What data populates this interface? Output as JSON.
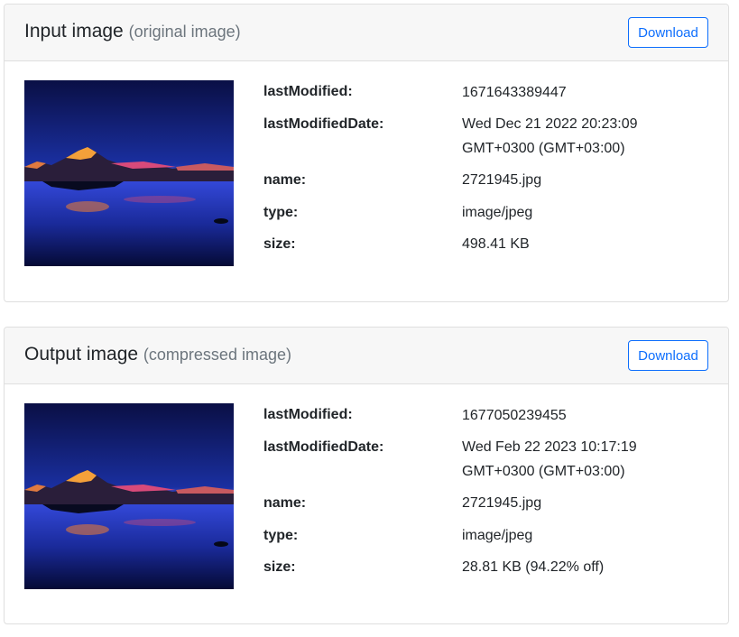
{
  "cards": {
    "input": {
      "title": "Input image",
      "subtitle": "(original image)",
      "download_label": "Download",
      "thumbnail": "night-mountain-lake-photo",
      "meta": {
        "lastModified": {
          "key": "lastModified:",
          "value": "1671643389447"
        },
        "lastModifiedDate": {
          "key": "lastModifiedDate:",
          "value": "Wed Dec 21 2022 20:23:09 GMT+0300 (GMT+03:00)"
        },
        "name": {
          "key": "name:",
          "value": "2721945.jpg"
        },
        "type": {
          "key": "type:",
          "value": "image/jpeg"
        },
        "size": {
          "key": "size:",
          "value": "498.41 KB"
        }
      }
    },
    "output": {
      "title": "Output image",
      "subtitle": "(compressed image)",
      "download_label": "Download",
      "thumbnail": "night-mountain-lake-photo",
      "meta": {
        "lastModified": {
          "key": "lastModified:",
          "value": "1677050239455"
        },
        "lastModifiedDate": {
          "key": "lastModifiedDate:",
          "value": "Wed Feb 22 2023 10:17:19 GMT+0300 (GMT+03:00)"
        },
        "name": {
          "key": "name:",
          "value": "2721945.jpg"
        },
        "type": {
          "key": "type:",
          "value": "image/jpeg"
        },
        "size": {
          "key": "size:",
          "value": "28.81 KB (94.22% off)"
        }
      }
    }
  },
  "colors": {
    "accent": "#0d6efd",
    "header_bg": "#f7f7f7",
    "border": "#dfdfdf",
    "muted": "#6c757d"
  }
}
